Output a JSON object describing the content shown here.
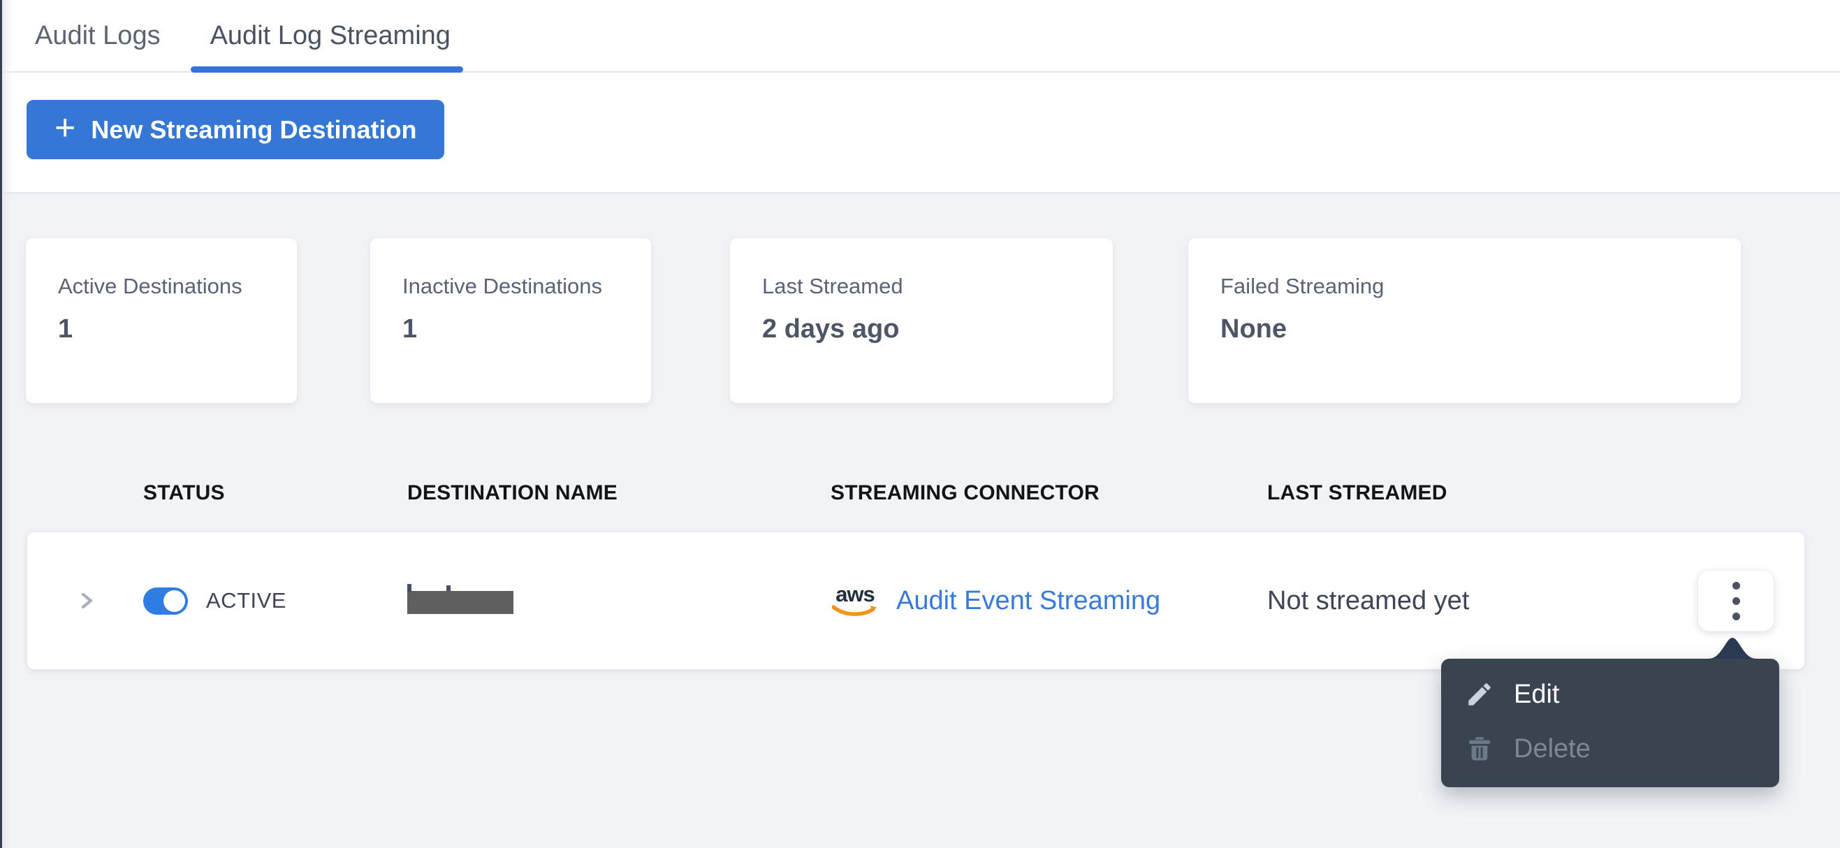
{
  "colors": {
    "accent_blue": "#3577d4",
    "tab_underline_blue": "#3573d9",
    "link_blue": "#3779dc",
    "toggle_blue": "#2f7de2",
    "menu_background": "#3a4450",
    "menu_caret": "#2b3a54",
    "aws_orange": "#f0941f",
    "page_background": "#f2f3f7"
  },
  "tabs": {
    "items": [
      {
        "label": "Audit Logs",
        "active": false
      },
      {
        "label": "Audit Log Streaming",
        "active": true
      }
    ]
  },
  "toolbar": {
    "plus_icon": "+",
    "new_button_label": "New Streaming Destination"
  },
  "stats": {
    "cards": [
      {
        "label": "Active Destinations",
        "value": "1"
      },
      {
        "label": "Inactive Destinations",
        "value": "1"
      },
      {
        "label": "Last Streamed",
        "value": "2 days ago"
      },
      {
        "label": "Failed Streaming",
        "value": "None"
      }
    ]
  },
  "table": {
    "columns": [
      {
        "label": "STATUS"
      },
      {
        "label": "DESTINATION NAME"
      },
      {
        "label": "STREAMING CONNECTOR"
      },
      {
        "label": "LAST STREAMED"
      }
    ],
    "row": {
      "status_label": "ACTIVE",
      "toggle_state": "on",
      "destination_name_redacted": true,
      "connector_brand_text": "aws",
      "connector_label": "Audit Event Streaming",
      "last_streamed": "Not streamed yet"
    }
  },
  "context_menu": {
    "items": [
      {
        "label": "Edit",
        "icon": "pencil",
        "disabled": false
      },
      {
        "label": "Delete",
        "icon": "trash",
        "disabled": true
      }
    ]
  }
}
